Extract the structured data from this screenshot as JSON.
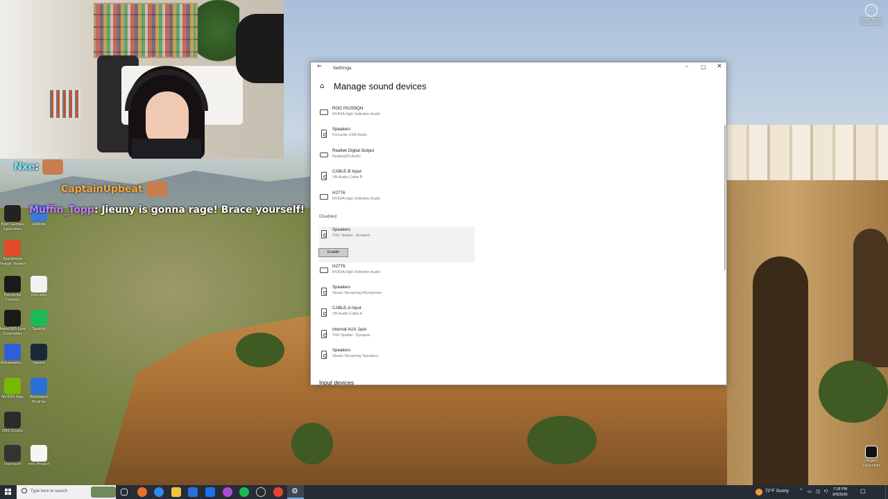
{
  "chat": [
    {
      "user": "Nxe",
      "message": ":"
    },
    {
      "user": "CaptainUpbeat",
      "message": ""
    },
    {
      "user": "Muffin_Topp",
      "message": ": Jieuny is gonna rage! Brace yourself!"
    }
  ],
  "desktop_icons": [
    {
      "label": "Epic Games Launcher",
      "icon": "epic-games-icon",
      "color": "#222222"
    },
    {
      "label": "UpNote",
      "icon": "upnote-icon",
      "color": "#3a7bd5"
    },
    {
      "label": "FastStone Image Viewer",
      "icon": "faststone-icon",
      "color": "#e04b2a"
    },
    {
      "label": "Focusrite Control",
      "icon": "focusrite-icon",
      "color": "#1a1a1a"
    },
    {
      "label": "mix.wav",
      "icon": "wav-file-icon",
      "color": "#f2f2f2"
    },
    {
      "label": "Astro360 Link Controller",
      "icon": "astro-icon",
      "color": "#1a1a1a"
    },
    {
      "label": "Spotify",
      "icon": "spotify-icon",
      "color": "#1db954"
    },
    {
      "label": "Malwareby...",
      "icon": "malwarebytes-icon",
      "color": "#2f5ed6"
    },
    {
      "label": "Steam",
      "icon": "steam-icon",
      "color": "#1b2838"
    },
    {
      "label": "NVIDIA App",
      "icon": "nvidia-icon",
      "color": "#76b900"
    },
    {
      "label": "Wallpaper Engine",
      "icon": "wallpaper-engine-icon",
      "color": "#2a6fd6"
    },
    {
      "label": "OBS Studio",
      "icon": "obs-icon",
      "color": "#2b2b2b"
    },
    {
      "label": "Overwolf",
      "icon": "overwolf-icon",
      "color": "#333333"
    },
    {
      "label": "mix Project",
      "icon": "project-file-icon",
      "color": "#f5f5f5"
    }
  ],
  "right_icons": [
    {
      "label": "Learn about this picture",
      "icon": "camera-icon"
    },
    {
      "label": "Ungen Launcher",
      "icon": "launcher-icon"
    }
  ],
  "settings": {
    "window_title": "Settings",
    "page_title": "Manage sound devices",
    "enabled_devices": [
      {
        "name": "ROG PG259QN",
        "driver": "NVIDIA High Definition Audio",
        "icon": "monitor-icon"
      },
      {
        "name": "Speakers",
        "driver": "Focusrite USB Audio",
        "icon": "speaker-icon"
      },
      {
        "name": "Realtek Digital Output",
        "driver": "Realtek(R) Audio",
        "icon": "digital-output-icon"
      },
      {
        "name": "CABLE-B Input",
        "driver": "VB-Audio Cable B",
        "icon": "speaker-icon"
      },
      {
        "name": "H27T6",
        "driver": "NVIDIA High Definition Audio",
        "icon": "monitor-icon"
      }
    ],
    "disabled_label": "Disabled",
    "disabled_devices": [
      {
        "name": "Speakers",
        "driver": "THX Spatial - Synapse",
        "icon": "speaker-icon"
      },
      {
        "name": "H27T6",
        "driver": "NVIDIA High Definition Audio",
        "icon": "monitor-icon"
      },
      {
        "name": "Speakers",
        "driver": "Steam Streaming Microphone",
        "icon": "speaker-icon"
      },
      {
        "name": "CABLE-A Input",
        "driver": "VB-Audio Cable A",
        "icon": "speaker-icon"
      },
      {
        "name": "Internal AUX Jack",
        "driver": "THX Spatial - Synapse",
        "icon": "speaker-icon"
      },
      {
        "name": "Speakers",
        "driver": "Steam Streaming Speakers",
        "icon": "speaker-icon"
      }
    ],
    "enable_button": "Enable",
    "input_devices_label": "Input devices"
  },
  "taskbar": {
    "search_placeholder": "Type here to search",
    "weather": "72°F Sunny",
    "time": "7:18 PM",
    "date": "8/9/2026"
  }
}
